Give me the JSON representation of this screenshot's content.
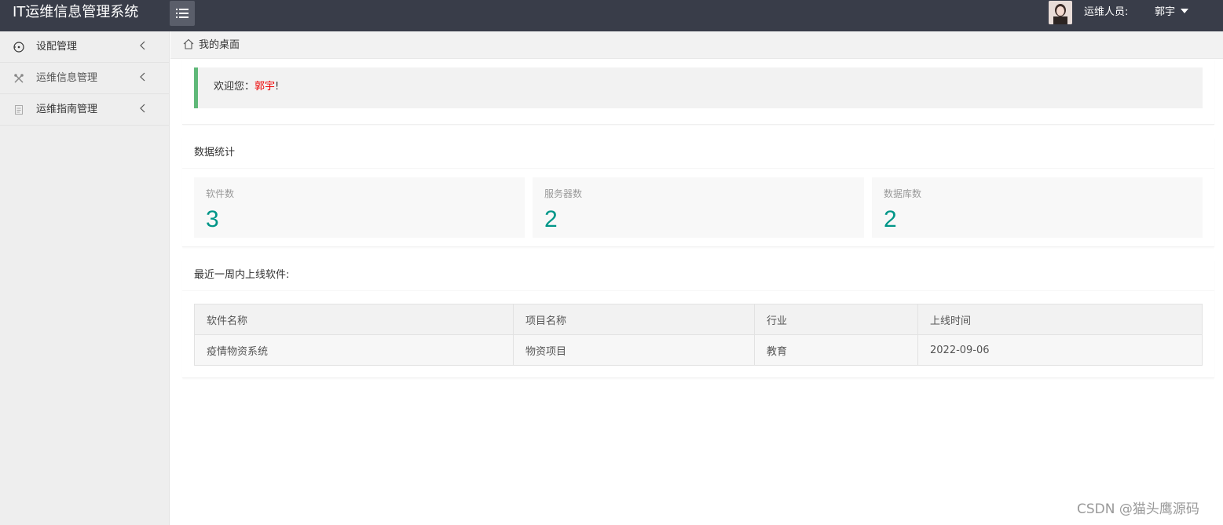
{
  "header": {
    "app_title": "IT运维信息管理系统",
    "user_role_label": "运维人员:",
    "user_name": "郭宇",
    "background_color": "#393d49"
  },
  "sidebar": {
    "items": [
      {
        "label": "设配管理",
        "icon": "gauge-icon"
      },
      {
        "label": "运维信息管理",
        "icon": "tools-icon"
      },
      {
        "label": "运维指南管理",
        "icon": "document-icon"
      }
    ]
  },
  "breadcrumb": {
    "label": "我的桌面",
    "icon": "home-icon"
  },
  "welcome": {
    "prefix": "欢迎您：",
    "name": "郭宇",
    "suffix": "!",
    "accent_color": "#5fb878"
  },
  "stats": {
    "title": "数据统计",
    "items": [
      {
        "label": "软件数",
        "value": "3"
      },
      {
        "label": "服务器数",
        "value": "2"
      },
      {
        "label": "数据库数",
        "value": "2"
      }
    ],
    "value_color": "#009688"
  },
  "recent": {
    "title": "最近一周内上线软件:",
    "columns": [
      "软件名称",
      "项目名称",
      "行业",
      "上线时间"
    ],
    "rows": [
      [
        "疫情物资系统",
        "物资项目",
        "教育",
        "2022-09-06"
      ]
    ]
  },
  "watermark": "CSDN @猫头鹰源码"
}
